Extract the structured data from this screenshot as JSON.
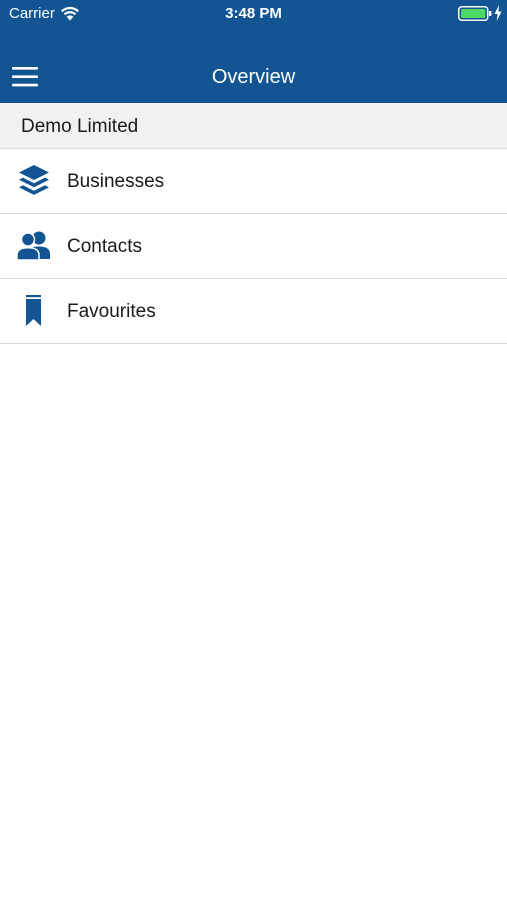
{
  "status_bar": {
    "carrier": "Carrier",
    "time": "3:48 PM",
    "wifi_icon": "wifi-icon",
    "battery_icon": "battery-icon",
    "charging_icon": "bolt-icon",
    "battery_color": "#4cd964"
  },
  "nav": {
    "title": "Overview",
    "menu_icon": "hamburger-menu-icon"
  },
  "section": {
    "title": "Demo Limited"
  },
  "menu": {
    "items": [
      {
        "label": "Businesses",
        "icon": "layers-icon"
      },
      {
        "label": "Contacts",
        "icon": "people-icon"
      },
      {
        "label": "Favourites",
        "icon": "bookmark-icon"
      }
    ]
  },
  "colors": {
    "header_bg": "#125592",
    "icon_color": "#125592",
    "section_bg": "#f1f1f1",
    "divider": "#d9d9d9"
  }
}
